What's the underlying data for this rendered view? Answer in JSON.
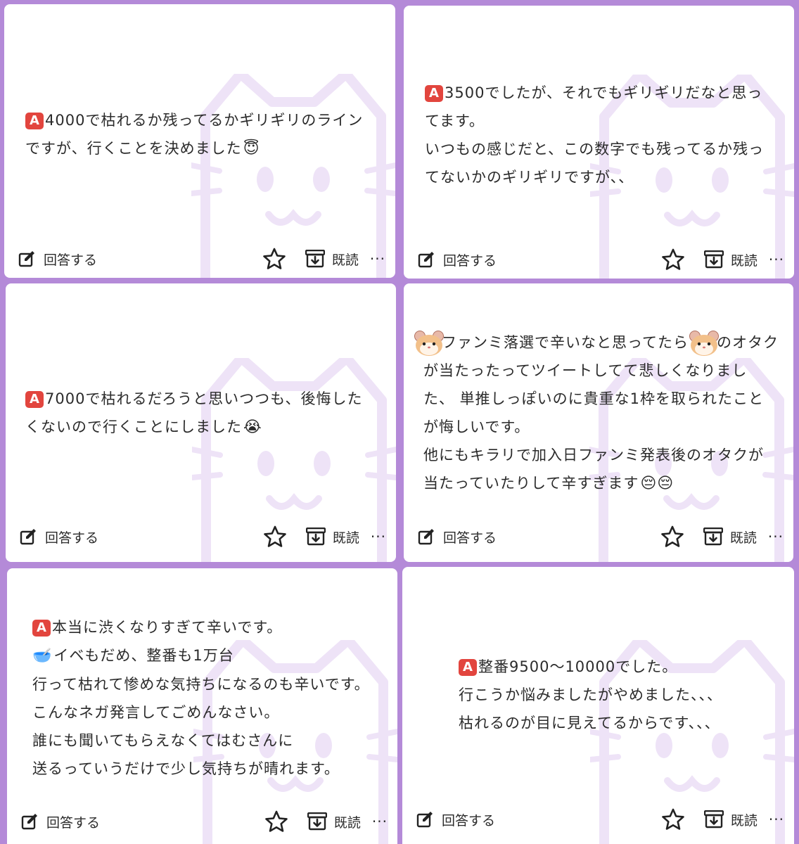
{
  "colors": {
    "background": "#b48ad8",
    "card": "#ffffff",
    "badge": "#e2453e"
  },
  "action_labels": {
    "reply": "回答する",
    "read": "既読",
    "more": "···"
  },
  "cards": [
    {
      "lines": [
        "4000で枯れるか残ってるかギリギリのライン",
        "ですが、行くことを決めました"
      ],
      "badge": "A",
      "end_emoji": "😇"
    },
    {
      "lines": [
        "3500でしたが、それでもギリギリだなと思っ",
        "てます。",
        "いつもの感じだと、この数字でも残ってるか残っ",
        "てないかのギリギリですが、、"
      ],
      "badge": "A"
    },
    {
      "lines": [
        "7000で枯れるだろうと思いつつも、後悔した",
        "くないので行くことにしました"
      ],
      "badge": "A",
      "end_emoji": "😭"
    },
    {
      "lines": [
        "ファンミ落選で辛いなと思ってたら",
        "のオタク",
        "が当たったってツイートしてて悲しくなりまし",
        "た、 単推しっぽいのに貴重な1枠を取られたこと",
        "が悔しいです。",
        "他にもキラリで加入日ファンミ発表後のオタクが",
        "当たっていたりして辛すぎます"
      ],
      "end_emoji": "😔😔"
    },
    {
      "lines": [
        "本当に渋くなりすぎて辛いです。",
        "イベもだめ、整番も1万台",
        "行って枯れて惨めな気持ちになるのも辛いです。",
        "こんなネガ発言してごめんなさい。",
        "誰にも聞いてもらえなくてはむさんに",
        "送るっていうだけで少し気持ちが晴れます。"
      ],
      "badge": "A",
      "second_emoji": "🥣"
    },
    {
      "lines": [
        "整番9500〜10000でした。",
        "行こうか悩みましたがやめました、、、",
        "枯れるのが目に見えてるからです、、、"
      ],
      "badge": "A"
    }
  ]
}
